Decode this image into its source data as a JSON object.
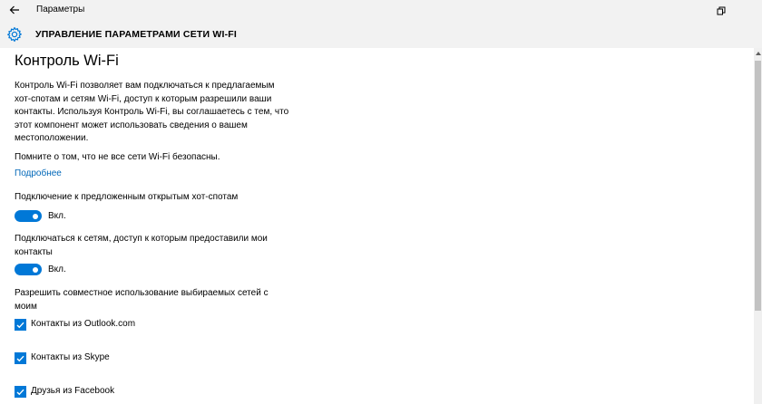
{
  "window": {
    "title": "Параметры"
  },
  "header": {
    "title": "УПРАВЛЕНИЕ ПАРАМЕТРАМИ СЕТИ WI-FI",
    "icon": "gear-icon"
  },
  "main": {
    "page_title": "Контроль Wi-Fi",
    "description_lines": [
      "Контроль Wi-Fi позволяет вам подключаться к предлагаемым",
      "хот-спотам и сетям Wi-Fi, доступ к которым разрешили ваши",
      "контакты. Используя Контроль Wi-Fi, вы соглашаетесь с тем, что",
      "этот компонент может использовать сведения о вашем",
      "местоположении."
    ],
    "notice": "Помните о том, что не все сети Wi-Fi безопасны.",
    "learn_more_link": "Подробнее",
    "toggles": [
      {
        "label_lines": [
          "Подключение к предложенным открытым хот-спотам"
        ],
        "state_label": "Вкл.",
        "on": true
      },
      {
        "label_lines": [
          "Подключаться к сетям, доступ к которым предоставили мои",
          "контакты"
        ],
        "state_label": "Вкл.",
        "on": true
      }
    ],
    "share_label_lines": [
      "Разрешить совместное использование выбираемых сетей с",
      "моим"
    ],
    "checkboxes": [
      {
        "label": "Контакты из Outlook.com",
        "checked": true
      },
      {
        "label": "Контакты из Skype",
        "checked": true
      },
      {
        "label": "Друзья из Facebook",
        "checked": true
      }
    ]
  },
  "colors": {
    "accent": "#0078d7",
    "link": "#0067b8",
    "chrome": "#f2f2f2"
  }
}
